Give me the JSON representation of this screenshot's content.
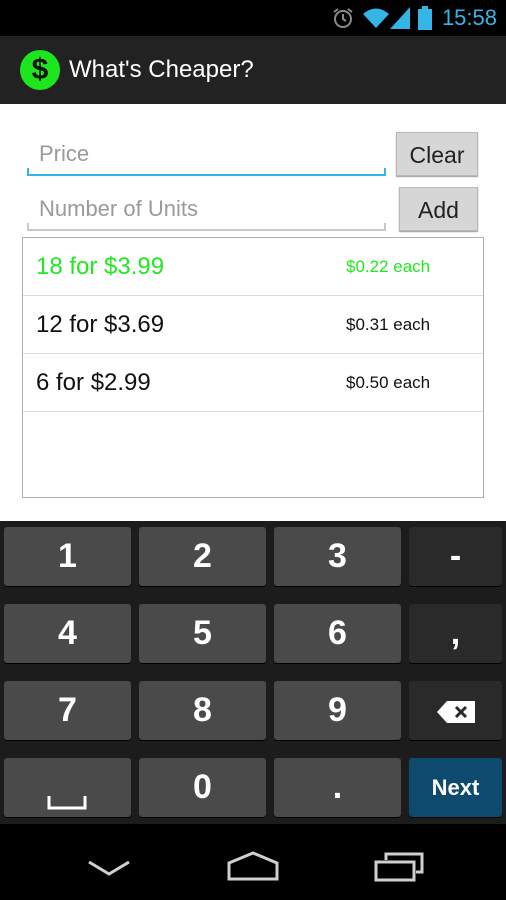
{
  "status_bar": {
    "time": "15:58",
    "icons": [
      "alarm-icon",
      "wifi-icon",
      "signal-icon",
      "battery-icon"
    ],
    "accent": "#33b5e5"
  },
  "action_bar": {
    "logo_symbol": "$",
    "title": "What's Cheaper?",
    "logo_color": "#1ee61e"
  },
  "form": {
    "price": {
      "value": "",
      "placeholder": "Price"
    },
    "units": {
      "value": "",
      "placeholder": "Number of Units"
    },
    "clear_label": "Clear",
    "add_label": "Add"
  },
  "items": [
    {
      "quantity_price": "18 for $3.99",
      "unit_price": "$0.22 each",
      "cheapest": true
    },
    {
      "quantity_price": "12 for $3.69",
      "unit_price": "$0.31 each",
      "cheapest": false
    },
    {
      "quantity_price": "6 for $2.99",
      "unit_price": "$0.50 each",
      "cheapest": false
    }
  ],
  "highlight_color": "#22e822",
  "keyboard": {
    "keys": [
      "1",
      "2",
      "3",
      "-",
      "4",
      "5",
      "6",
      ",",
      "7",
      "8",
      "9",
      "backspace",
      "space",
      "0",
      ".",
      "Next"
    ],
    "k1": "1",
    "k2": "2",
    "k3": "3",
    "kminus": "-",
    "k4": "4",
    "k5": "5",
    "k6": "6",
    "kcomma": ",",
    "k7": "7",
    "k8": "8",
    "k9": "9",
    "k0": "0",
    "kdot": ".",
    "next": "Next"
  },
  "nav_bar": {
    "buttons": [
      "back-icon",
      "home-icon",
      "recent-apps-icon"
    ]
  }
}
